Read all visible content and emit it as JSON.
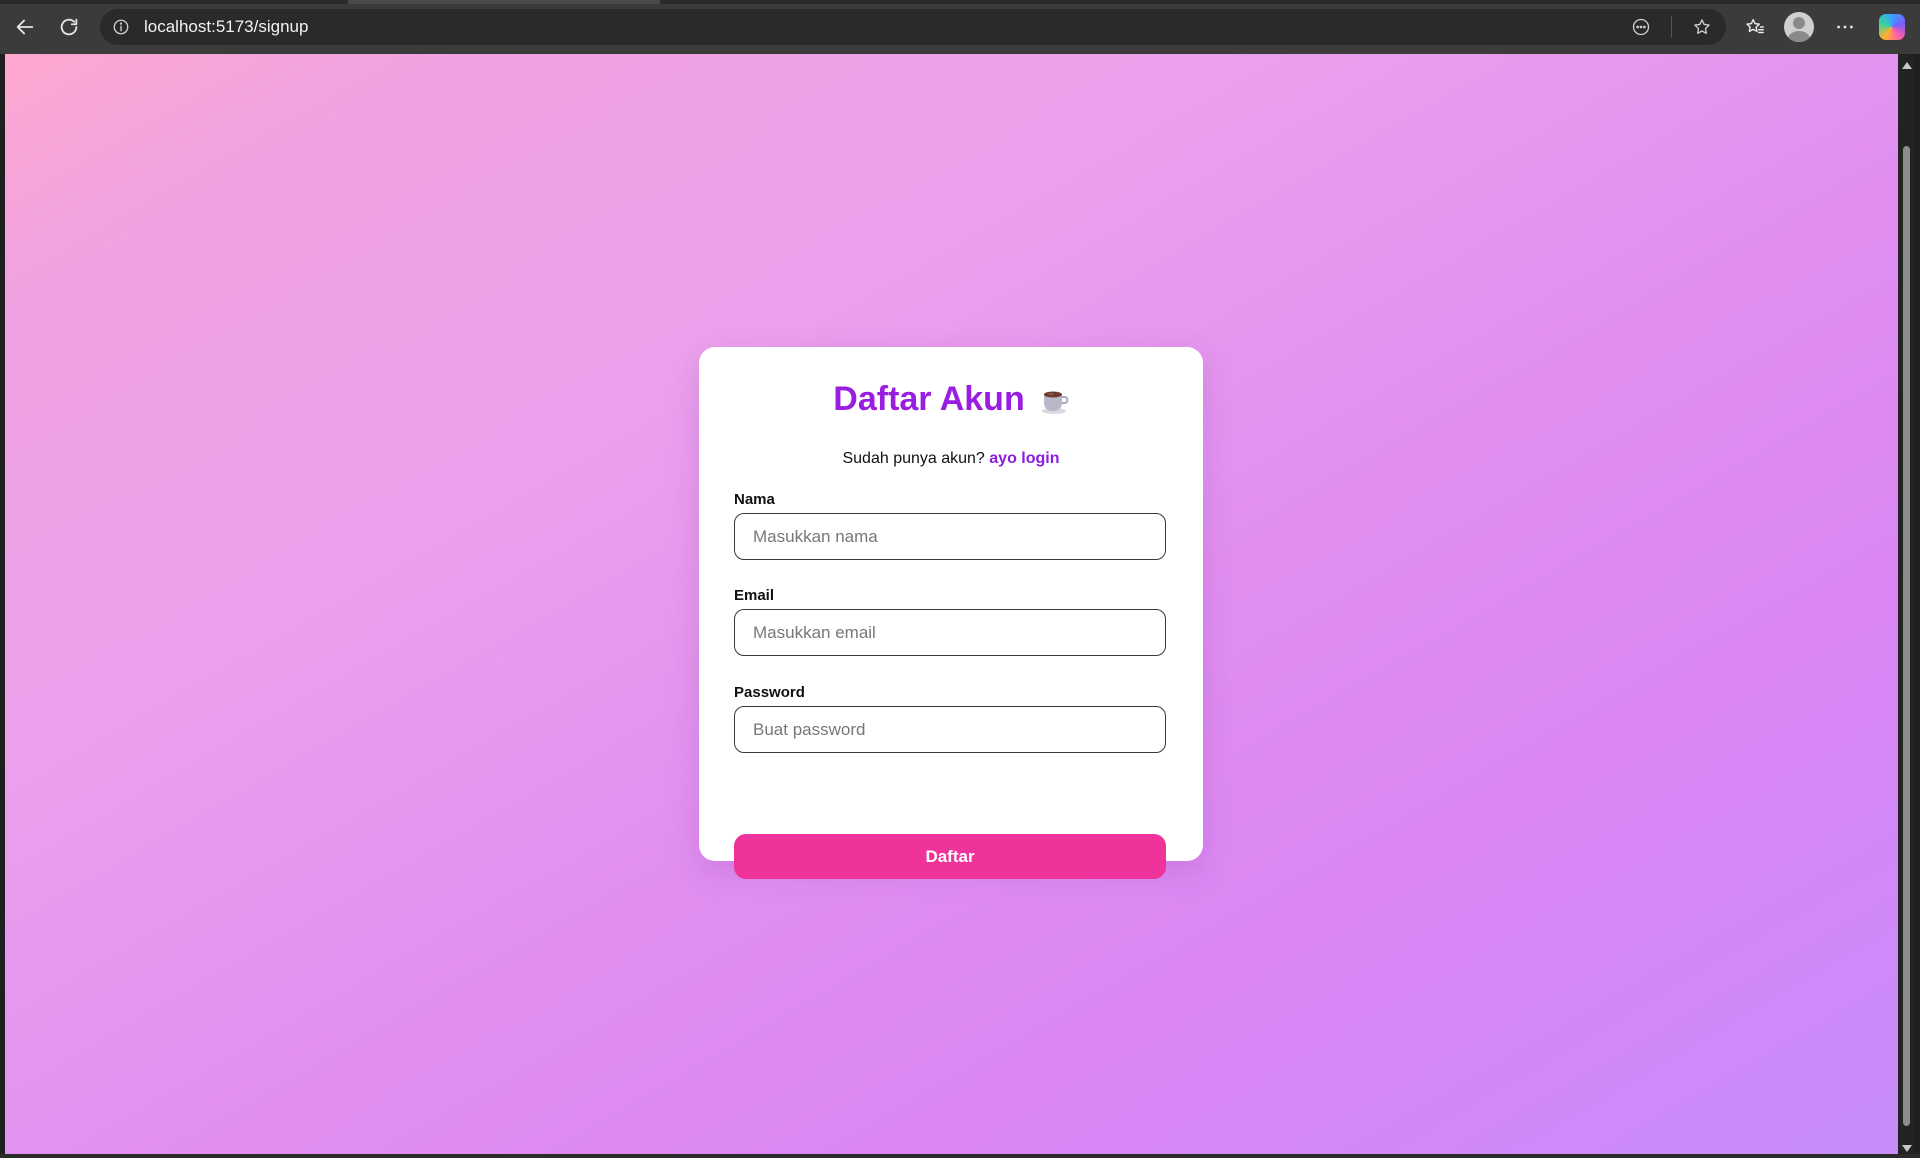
{
  "browser": {
    "url": "localhost:5173/signup",
    "icons": {
      "back": "back-arrow-icon",
      "reload": "reload-icon",
      "site_info": "info-icon",
      "reader": "reader-mode-icon",
      "favorite": "star-icon",
      "favorites_list": "favorites-icon",
      "profile": "profile-avatar-icon",
      "more": "more-icon",
      "copilot": "copilot-icon"
    }
  },
  "page": {
    "background_colors": [
      "#ffa7cf",
      "#eba1ec",
      "#d986f4",
      "#c78cfa"
    ]
  },
  "form": {
    "title": "Daftar Akun",
    "title_emoji": "coffee-cup-icon",
    "title_color": "#9a1ee0",
    "subtitle_text": "Sudah punya akun?",
    "subtitle_link": "ayo login",
    "fields": [
      {
        "label": "Nama",
        "placeholder": "Masukkan nama",
        "value": ""
      },
      {
        "label": "Email",
        "placeholder": "Masukkan email",
        "value": ""
      },
      {
        "label": "Password",
        "placeholder": "Buat password",
        "value": ""
      }
    ],
    "submit_label": "Daftar",
    "submit_color": "#f0339a"
  }
}
